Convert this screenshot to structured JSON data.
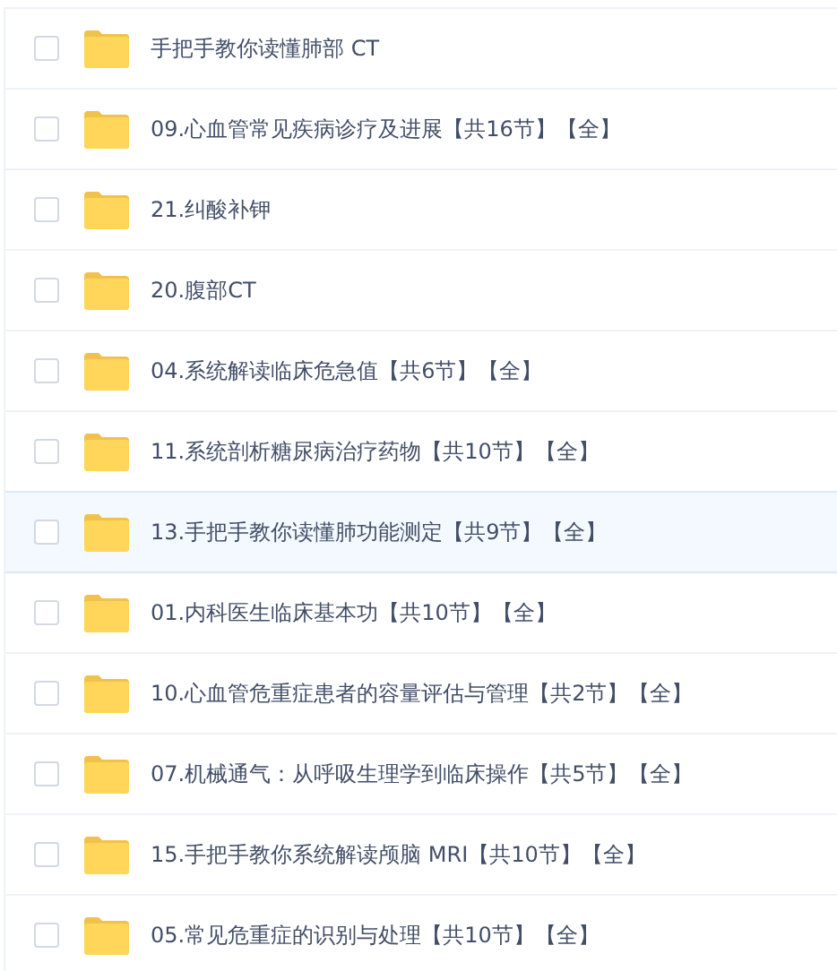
{
  "files": [
    {
      "name": "手把手教你读懂肺部 CT",
      "checked": false,
      "selected": false
    },
    {
      "name": "09.心血管常见疾病诊疗及进展【共16节】【全】",
      "checked": false,
      "selected": false
    },
    {
      "name": "21.纠酸补钾",
      "checked": false,
      "selected": false
    },
    {
      "name": "20.腹部CT",
      "checked": false,
      "selected": false
    },
    {
      "name": "04.系统解读临床危急值【共6节】【全】",
      "checked": false,
      "selected": false
    },
    {
      "name": "11.系统剖析糖尿病治疗药物【共10节】【全】",
      "checked": false,
      "selected": false
    },
    {
      "name": "13.手把手教你读懂肺功能测定【共9节】【全】",
      "checked": false,
      "selected": true
    },
    {
      "name": "01.内科医生临床基本功【共10节】【全】",
      "checked": false,
      "selected": false
    },
    {
      "name": "10.心血管危重症患者的容量评估与管理【共2节】【全】",
      "checked": false,
      "selected": false
    },
    {
      "name": "07.机械通气：从呼吸生理学到临床操作【共5节】【全】",
      "checked": false,
      "selected": false
    },
    {
      "name": "15.手把手教你系统解读颅脑 MRI【共10节】【全】",
      "checked": false,
      "selected": false
    },
    {
      "name": "05.常见危重症的识别与处理【共10节】【全】",
      "checked": false,
      "selected": false
    }
  ]
}
